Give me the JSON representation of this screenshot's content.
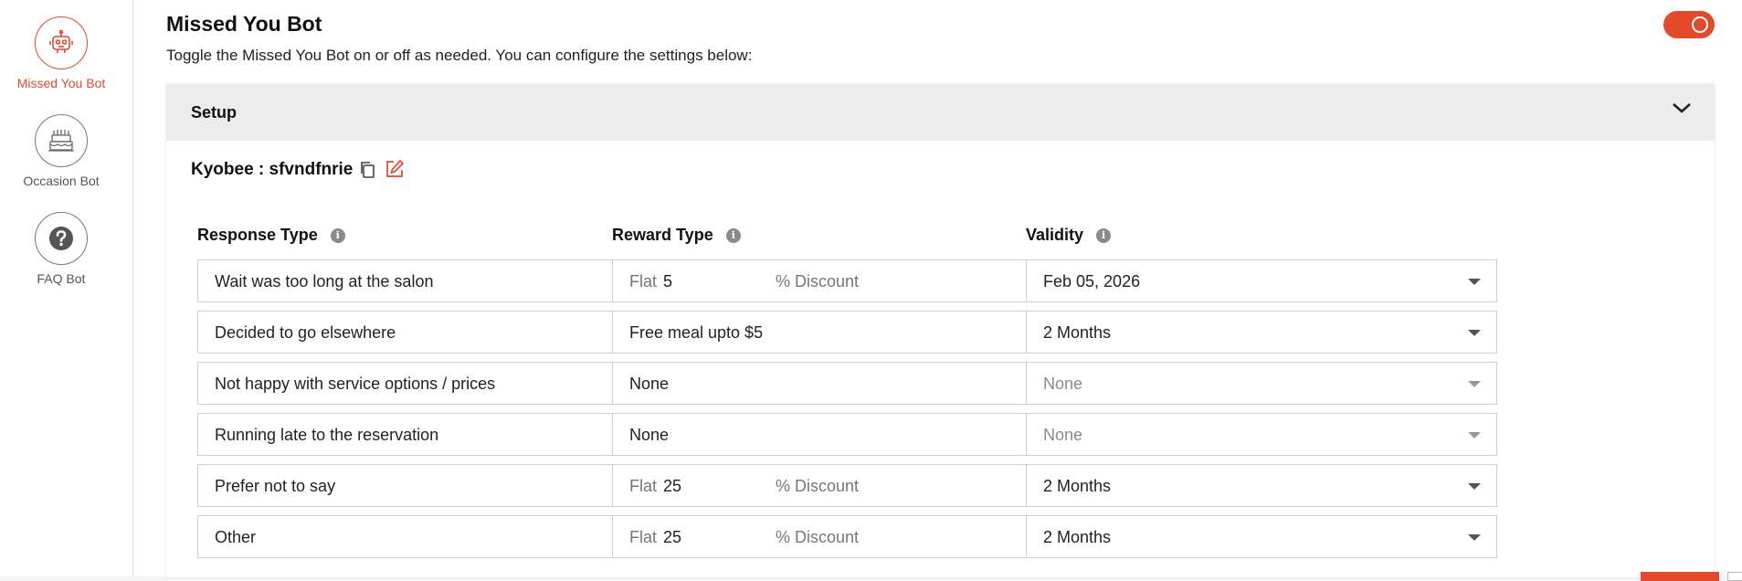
{
  "sidebar": {
    "items": [
      {
        "label": "Missed You Bot",
        "icon": "robot-icon",
        "active": true
      },
      {
        "label": "Occasion Bot",
        "icon": "cake-icon",
        "active": false
      },
      {
        "label": "FAQ Bot",
        "icon": "question-icon",
        "active": false
      }
    ]
  },
  "header": {
    "title": "Missed You Bot",
    "subtitle": "Toggle the Missed You Bot on or off as needed. You can configure the settings below:",
    "toggle_on": true
  },
  "setup": {
    "label": "Setup",
    "kyobee_label": "Kyobee : sfvndfnrie"
  },
  "columns": {
    "response": "Response Type",
    "reward": "Reward Type",
    "validity": "Validity",
    "info_glyph": "i"
  },
  "rows": [
    {
      "response": "Wait was too long at the salon",
      "reward": {
        "kind": "flat",
        "prefix": "Flat",
        "amount": "5",
        "suffix": "% Discount"
      },
      "validity": "Feb 05, 2026",
      "validity_disabled": false
    },
    {
      "response": "Decided to go elsewhere",
      "reward": {
        "kind": "text",
        "text": "Free meal upto $5"
      },
      "validity": "2 Months",
      "validity_disabled": false
    },
    {
      "response": "Not happy with service options / prices",
      "reward": {
        "kind": "text",
        "text": "None"
      },
      "validity": "None",
      "validity_disabled": true
    },
    {
      "response": "Running late to the reservation",
      "reward": {
        "kind": "text",
        "text": "None"
      },
      "validity": "None",
      "validity_disabled": true
    },
    {
      "response": "Prefer not to say",
      "reward": {
        "kind": "flat",
        "prefix": "Flat",
        "amount": "25",
        "suffix": "% Discount"
      },
      "validity": "2 Months",
      "validity_disabled": false
    },
    {
      "response": "Other",
      "reward": {
        "kind": "flat",
        "prefix": "Flat",
        "amount": "25",
        "suffix": "% Discount"
      },
      "validity": "2 Months",
      "validity_disabled": false
    }
  ],
  "colors": {
    "accent": "#e24a2a",
    "panel_header": "#ececec",
    "border": "#cfcfcf"
  }
}
